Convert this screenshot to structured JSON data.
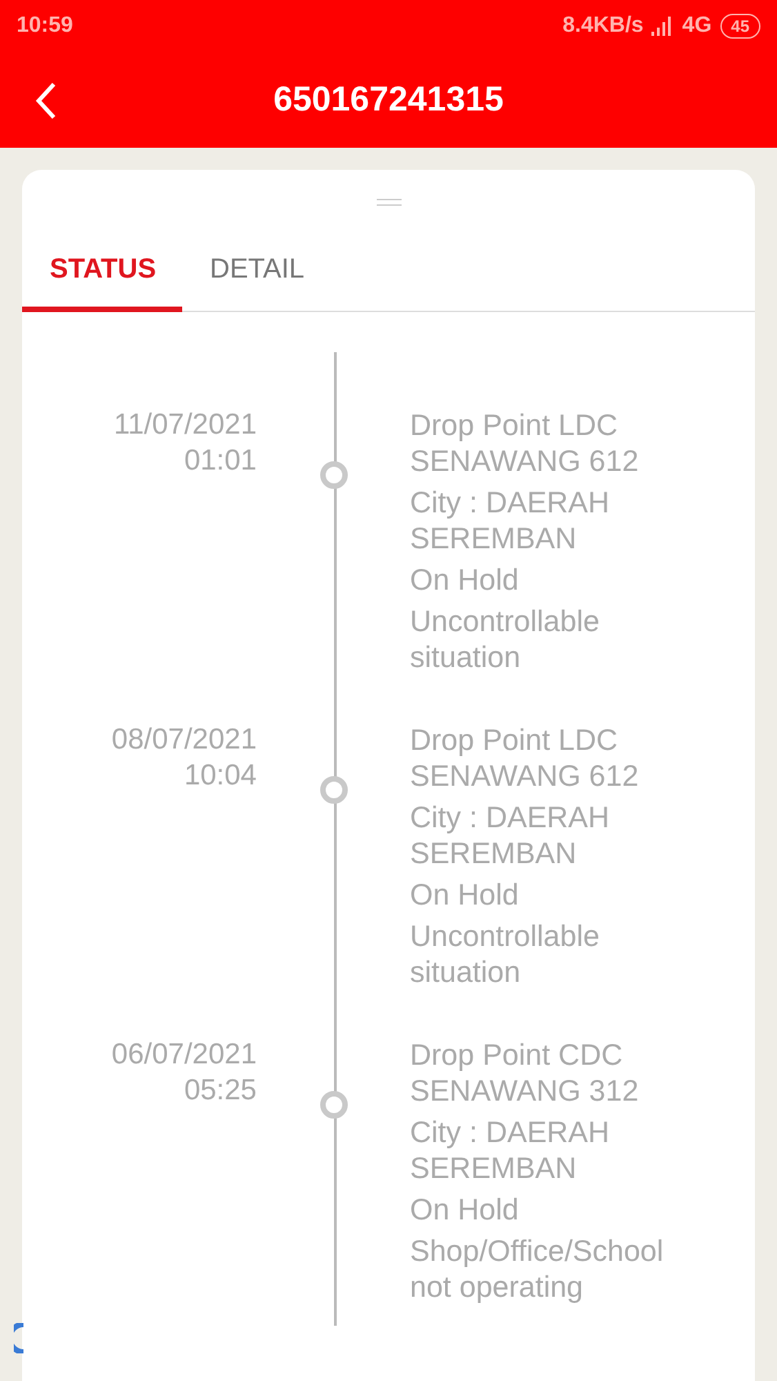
{
  "status_bar": {
    "time": "10:59",
    "network_speed": "8.4KB/s",
    "network": "4G",
    "battery": "45"
  },
  "header": {
    "title": "650167241315"
  },
  "tabs": [
    {
      "label": "STATUS",
      "selected": true
    },
    {
      "label": "DETAIL",
      "selected": false
    }
  ],
  "events": [
    {
      "date": "11/07/2021",
      "time": "01:01",
      "lines": [
        "Drop Point LDC SENAWANG 612",
        "City : DAERAH SEREMBAN",
        "On Hold",
        "Uncontrollable situation"
      ]
    },
    {
      "date": "08/07/2021",
      "time": "10:04",
      "lines": [
        "Drop Point LDC SENAWANG 612",
        "City : DAERAH SEREMBAN",
        "On Hold",
        "Uncontrollable situation"
      ]
    },
    {
      "date": "06/07/2021",
      "time": "05:25",
      "lines": [
        "Drop Point CDC SENAWANG 312",
        "City : DAERAH SEREMBAN",
        "On Hold",
        "Shop/Office/School not operating"
      ]
    }
  ]
}
